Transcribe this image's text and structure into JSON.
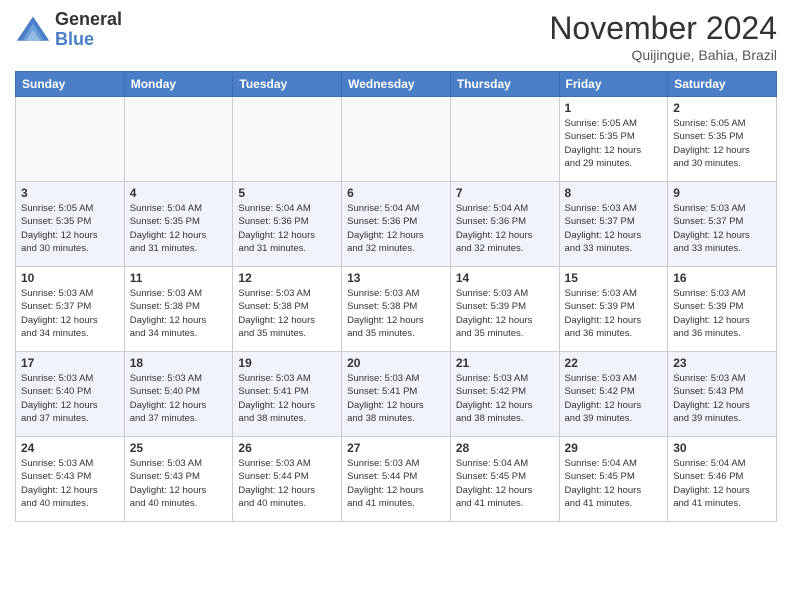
{
  "header": {
    "logo_general": "General",
    "logo_blue": "Blue",
    "month_title": "November 2024",
    "location": "Quijingue, Bahia, Brazil"
  },
  "weekdays": [
    "Sunday",
    "Monday",
    "Tuesday",
    "Wednesday",
    "Thursday",
    "Friday",
    "Saturday"
  ],
  "weeks": [
    [
      {
        "day": "",
        "info": ""
      },
      {
        "day": "",
        "info": ""
      },
      {
        "day": "",
        "info": ""
      },
      {
        "day": "",
        "info": ""
      },
      {
        "day": "",
        "info": ""
      },
      {
        "day": "1",
        "info": "Sunrise: 5:05 AM\nSunset: 5:35 PM\nDaylight: 12 hours\nand 29 minutes."
      },
      {
        "day": "2",
        "info": "Sunrise: 5:05 AM\nSunset: 5:35 PM\nDaylight: 12 hours\nand 30 minutes."
      }
    ],
    [
      {
        "day": "3",
        "info": "Sunrise: 5:05 AM\nSunset: 5:35 PM\nDaylight: 12 hours\nand 30 minutes."
      },
      {
        "day": "4",
        "info": "Sunrise: 5:04 AM\nSunset: 5:35 PM\nDaylight: 12 hours\nand 31 minutes."
      },
      {
        "day": "5",
        "info": "Sunrise: 5:04 AM\nSunset: 5:36 PM\nDaylight: 12 hours\nand 31 minutes."
      },
      {
        "day": "6",
        "info": "Sunrise: 5:04 AM\nSunset: 5:36 PM\nDaylight: 12 hours\nand 32 minutes."
      },
      {
        "day": "7",
        "info": "Sunrise: 5:04 AM\nSunset: 5:36 PM\nDaylight: 12 hours\nand 32 minutes."
      },
      {
        "day": "8",
        "info": "Sunrise: 5:03 AM\nSunset: 5:37 PM\nDaylight: 12 hours\nand 33 minutes."
      },
      {
        "day": "9",
        "info": "Sunrise: 5:03 AM\nSunset: 5:37 PM\nDaylight: 12 hours\nand 33 minutes."
      }
    ],
    [
      {
        "day": "10",
        "info": "Sunrise: 5:03 AM\nSunset: 5:37 PM\nDaylight: 12 hours\nand 34 minutes."
      },
      {
        "day": "11",
        "info": "Sunrise: 5:03 AM\nSunset: 5:38 PM\nDaylight: 12 hours\nand 34 minutes."
      },
      {
        "day": "12",
        "info": "Sunrise: 5:03 AM\nSunset: 5:38 PM\nDaylight: 12 hours\nand 35 minutes."
      },
      {
        "day": "13",
        "info": "Sunrise: 5:03 AM\nSunset: 5:38 PM\nDaylight: 12 hours\nand 35 minutes."
      },
      {
        "day": "14",
        "info": "Sunrise: 5:03 AM\nSunset: 5:39 PM\nDaylight: 12 hours\nand 35 minutes."
      },
      {
        "day": "15",
        "info": "Sunrise: 5:03 AM\nSunset: 5:39 PM\nDaylight: 12 hours\nand 36 minutes."
      },
      {
        "day": "16",
        "info": "Sunrise: 5:03 AM\nSunset: 5:39 PM\nDaylight: 12 hours\nand 36 minutes."
      }
    ],
    [
      {
        "day": "17",
        "info": "Sunrise: 5:03 AM\nSunset: 5:40 PM\nDaylight: 12 hours\nand 37 minutes."
      },
      {
        "day": "18",
        "info": "Sunrise: 5:03 AM\nSunset: 5:40 PM\nDaylight: 12 hours\nand 37 minutes."
      },
      {
        "day": "19",
        "info": "Sunrise: 5:03 AM\nSunset: 5:41 PM\nDaylight: 12 hours\nand 38 minutes."
      },
      {
        "day": "20",
        "info": "Sunrise: 5:03 AM\nSunset: 5:41 PM\nDaylight: 12 hours\nand 38 minutes."
      },
      {
        "day": "21",
        "info": "Sunrise: 5:03 AM\nSunset: 5:42 PM\nDaylight: 12 hours\nand 38 minutes."
      },
      {
        "day": "22",
        "info": "Sunrise: 5:03 AM\nSunset: 5:42 PM\nDaylight: 12 hours\nand 39 minutes."
      },
      {
        "day": "23",
        "info": "Sunrise: 5:03 AM\nSunset: 5:43 PM\nDaylight: 12 hours\nand 39 minutes."
      }
    ],
    [
      {
        "day": "24",
        "info": "Sunrise: 5:03 AM\nSunset: 5:43 PM\nDaylight: 12 hours\nand 40 minutes."
      },
      {
        "day": "25",
        "info": "Sunrise: 5:03 AM\nSunset: 5:43 PM\nDaylight: 12 hours\nand 40 minutes."
      },
      {
        "day": "26",
        "info": "Sunrise: 5:03 AM\nSunset: 5:44 PM\nDaylight: 12 hours\nand 40 minutes."
      },
      {
        "day": "27",
        "info": "Sunrise: 5:03 AM\nSunset: 5:44 PM\nDaylight: 12 hours\nand 41 minutes."
      },
      {
        "day": "28",
        "info": "Sunrise: 5:04 AM\nSunset: 5:45 PM\nDaylight: 12 hours\nand 41 minutes."
      },
      {
        "day": "29",
        "info": "Sunrise: 5:04 AM\nSunset: 5:45 PM\nDaylight: 12 hours\nand 41 minutes."
      },
      {
        "day": "30",
        "info": "Sunrise: 5:04 AM\nSunset: 5:46 PM\nDaylight: 12 hours\nand 41 minutes."
      }
    ]
  ]
}
